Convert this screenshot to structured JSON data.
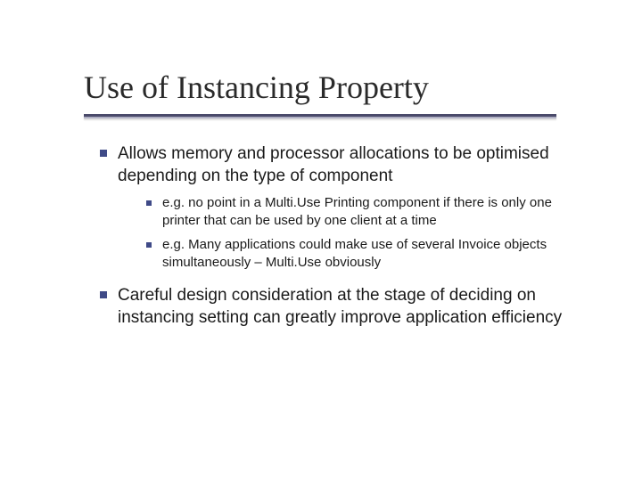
{
  "slide": {
    "title": "Use of Instancing Property",
    "bullets": [
      {
        "text": "Allows memory and processor allocations to be optimised depending on the type of component",
        "children": [
          {
            "text": "e.g. no point in a Multi.Use Printing component if there is only one printer that can be used by one client at a time"
          },
          {
            "text": "e.g. Many applications could make use of several Invoice objects simultaneously – Multi.Use obviously"
          }
        ]
      },
      {
        "text": "Careful design consideration at the stage of deciding on instancing setting can greatly improve application efficiency",
        "children": []
      }
    ]
  },
  "colors": {
    "bullet": "#3f4a87",
    "underline_dark": "#4a4a6a",
    "underline_light": "#b0b0c4"
  }
}
